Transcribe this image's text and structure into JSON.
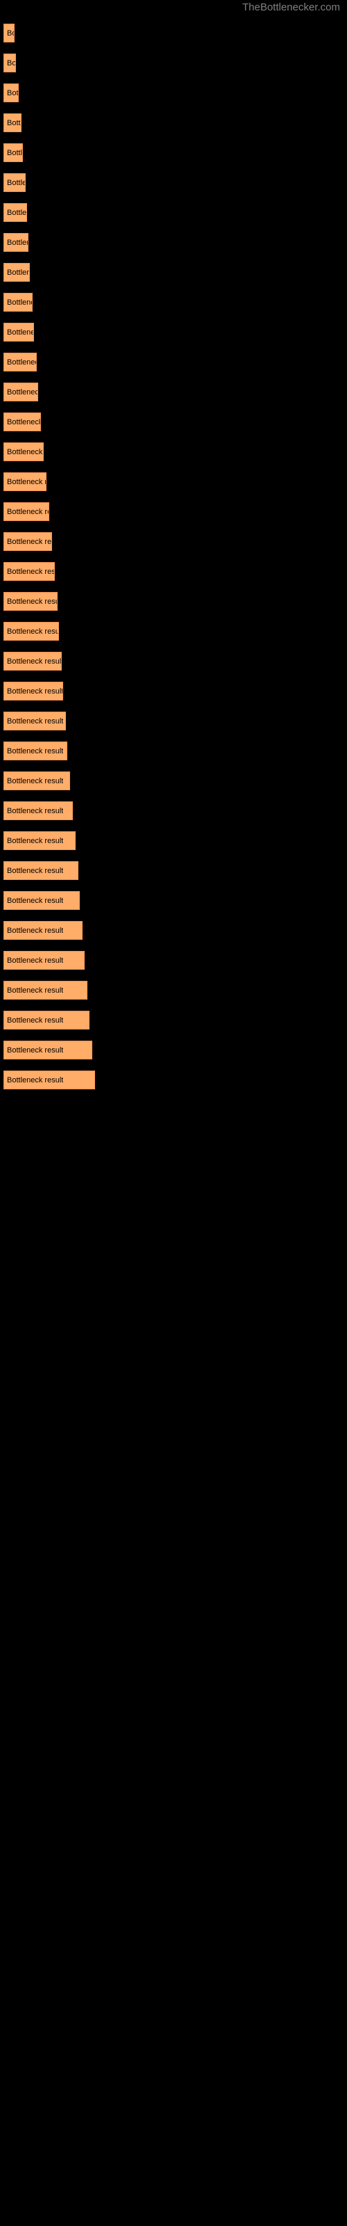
{
  "watermark": "TheBottlenecker.com",
  "chart_data": {
    "type": "bar",
    "title": "",
    "xlabel": "",
    "ylabel": "",
    "orientation": "horizontal",
    "bar_color": "#ffad69",
    "background": "#000000",
    "categories": [
      "Bottleneck result",
      "Bottleneck result",
      "Bottleneck result",
      "Bottleneck result",
      "Bottleneck result",
      "Bottleneck result",
      "Bottleneck result",
      "Bottleneck result",
      "Bottleneck result",
      "Bottleneck result",
      "Bottleneck result",
      "Bottleneck result",
      "Bottleneck result",
      "Bottleneck result",
      "Bottleneck result",
      "Bottleneck result",
      "Bottleneck result",
      "Bottleneck result",
      "Bottleneck result",
      "Bottleneck result",
      "Bottleneck result",
      "Bottleneck result",
      "Bottleneck result",
      "Bottleneck result",
      "Bottleneck result",
      "Bottleneck result",
      "Bottleneck result",
      "Bottleneck result",
      "Bottleneck result",
      "Bottleneck result",
      "Bottleneck result",
      "Bottleneck result",
      "Bottleneck result",
      "Bottleneck result",
      "Bottleneck result",
      "Bottleneck result"
    ],
    "values": [
      16,
      18,
      22,
      26,
      28,
      32,
      34,
      36,
      38,
      42,
      44,
      48,
      50,
      54,
      58,
      62,
      66,
      70,
      74,
      78,
      80,
      84,
      86,
      90,
      92,
      96,
      100,
      104,
      108,
      110,
      114,
      117,
      121,
      124,
      128,
      132
    ],
    "value_unit": "px",
    "xlim": [
      0,
      140
    ],
    "grid": false,
    "legend": false
  }
}
